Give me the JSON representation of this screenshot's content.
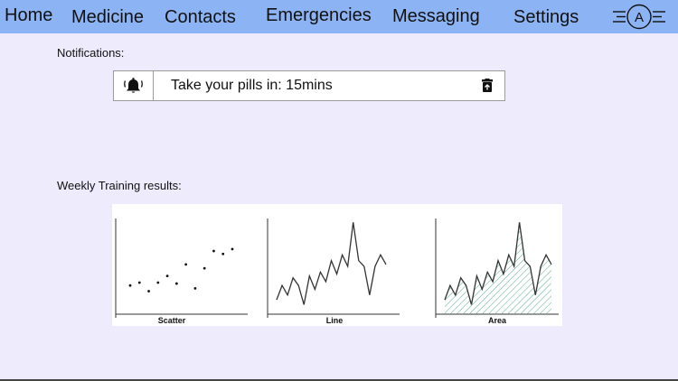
{
  "nav": {
    "home": "Home",
    "medicine": "Medicine",
    "contacts": "Contacts",
    "emergencies": "Emergencies",
    "messaging": "Messaging",
    "settings": "Settings",
    "avatar_initial": "A"
  },
  "notifications": {
    "label": "Notifications:",
    "items": [
      {
        "text": "Take your pills in: 15mins",
        "icon": "bell-icon",
        "action_icon": "delete-icon"
      }
    ]
  },
  "training": {
    "label": "Weekly Training results:"
  },
  "chart_data": [
    {
      "type": "scatter",
      "caption": "Scatter",
      "x": [
        1,
        2,
        3,
        4,
        5,
        6,
        7,
        8,
        9,
        10,
        11,
        12
      ],
      "y": [
        3.0,
        3.3,
        2.4,
        3.3,
        4.0,
        3.2,
        5.2,
        2.7,
        4.8,
        6.6,
        6.3,
        6.8
      ]
    },
    {
      "type": "line",
      "caption": "Line",
      "x": [
        1,
        2,
        3,
        4,
        5,
        6,
        7,
        8,
        9,
        10,
        11,
        12,
        13,
        14,
        15,
        16,
        17,
        18,
        19,
        20,
        21
      ],
      "y": [
        1.5,
        3.0,
        2.0,
        3.8,
        3.0,
        1.0,
        4.0,
        2.6,
        4.4,
        3.4,
        5.6,
        4.2,
        6.2,
        5.0,
        9.6,
        5.6,
        5.0,
        2.0,
        5.0,
        6.2,
        5.2
      ]
    },
    {
      "type": "area",
      "caption": "Area",
      "x": [
        1,
        2,
        3,
        4,
        5,
        6,
        7,
        8,
        9,
        10,
        11,
        12,
        13,
        14,
        15,
        16,
        17,
        18,
        19,
        20,
        21
      ],
      "y": [
        1.5,
        3.0,
        2.0,
        3.8,
        3.0,
        1.0,
        4.0,
        2.6,
        4.4,
        3.4,
        5.6,
        4.2,
        6.2,
        5.0,
        9.6,
        5.6,
        5.0,
        2.0,
        5.0,
        6.2,
        5.2
      ]
    }
  ],
  "colors": {
    "topbar": "#8cb4f4",
    "background": "#eeecfc",
    "area_hatch": "#5aa88e"
  }
}
